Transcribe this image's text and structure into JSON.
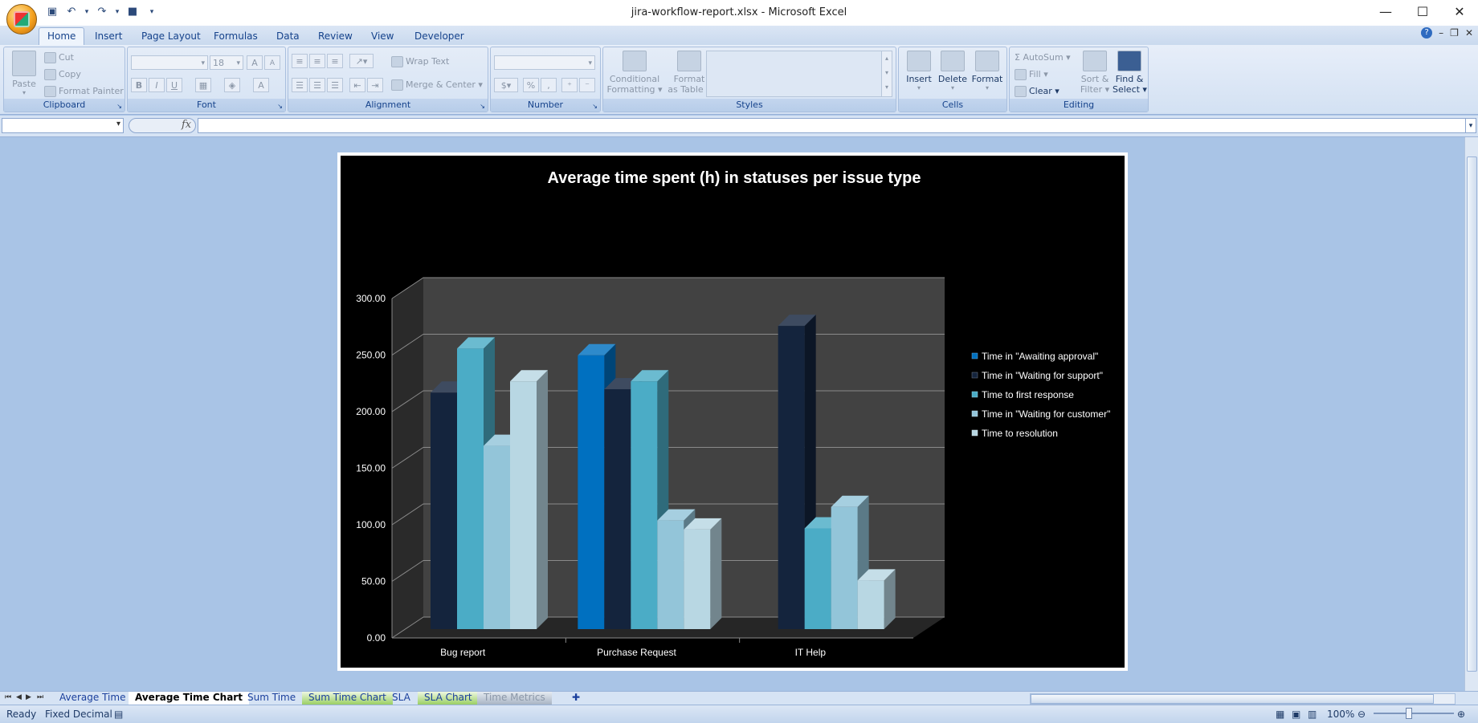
{
  "window": {
    "title": "jira-workflow-report.xlsx - Microsoft Excel"
  },
  "ribbon_tabs": [
    "Home",
    "Insert",
    "Page Layout",
    "Formulas",
    "Data",
    "Review",
    "View",
    "Developer"
  ],
  "clipboard": {
    "paste": "Paste",
    "cut": "Cut",
    "copy": "Copy",
    "format_painter": "Format Painter",
    "label": "Clipboard"
  },
  "font": {
    "font_size": "18",
    "bold": "B",
    "italic": "I",
    "underline": "U",
    "grow": "A",
    "shrink": "A",
    "font_color": "A",
    "label": "Font"
  },
  "alignment": {
    "wrap_text": "Wrap Text",
    "merge_center": "Merge & Center",
    "label": "Alignment"
  },
  "number": {
    "percent": "%",
    "comma": ",",
    "label": "Number"
  },
  "styles": {
    "conditional": [
      "Conditional",
      "Formatting"
    ],
    "format_table": [
      "Format",
      "as Table"
    ],
    "label": "Styles"
  },
  "cells": {
    "insert": "Insert",
    "delete": "Delete",
    "format": "Format",
    "label": "Cells"
  },
  "editing": {
    "autosum": "AutoSum",
    "fill": "Fill",
    "clear": "Clear",
    "sort_filter": [
      "Sort &",
      "Filter"
    ],
    "find_select": [
      "Find &",
      "Select"
    ],
    "label": "Editing",
    "sigma": "Σ"
  },
  "formula_bar": {
    "fx": "fx"
  },
  "sheet_tabs": [
    {
      "name": "Average Time",
      "active": false,
      "color": ""
    },
    {
      "name": "Average Time Chart",
      "active": true,
      "color": "#9bcf63"
    },
    {
      "name": "Sum Time",
      "active": false,
      "color": ""
    },
    {
      "name": "Sum Time Chart",
      "active": false,
      "color": "#9bcf63"
    },
    {
      "name": "SLA",
      "active": false,
      "color": ""
    },
    {
      "name": "SLA Chart",
      "active": false,
      "color": "#9bcf63"
    },
    {
      "name": "Time Metrics",
      "active": false,
      "color": "#a8b4c4"
    }
  ],
  "status": {
    "ready": "Ready",
    "mode": "Fixed Decimal",
    "zoom": "100%"
  },
  "chart_data": {
    "type": "bar",
    "title": "Average time spent (h) in statuses per issue type",
    "categories": [
      "Bug report",
      "Purchase Request",
      "IT Help"
    ],
    "series": [
      {
        "name": "Time in \"Awaiting approval\"",
        "color": "#0070c0",
        "values": [
          null,
          242,
          null
        ]
      },
      {
        "name": "Time in \"Waiting for support\"",
        "color": "#14243d",
        "values": [
          209,
          212,
          268
        ]
      },
      {
        "name": "Time to first response",
        "color": "#4bacc6",
        "values": [
          248,
          219,
          89
        ]
      },
      {
        "name": "Time in \"Waiting for customer\"",
        "color": "#93c5d9",
        "values": [
          162,
          96,
          108
        ]
      },
      {
        "name": "Time to resolution",
        "color": "#b8d7e3",
        "values": [
          219,
          88,
          43
        ]
      }
    ],
    "ylim": [
      0,
      300
    ],
    "yticks": [
      "0.00",
      "50.00",
      "100.00",
      "150.00",
      "200.00",
      "250.00",
      "300.00"
    ],
    "grid": true,
    "legend": "right"
  }
}
